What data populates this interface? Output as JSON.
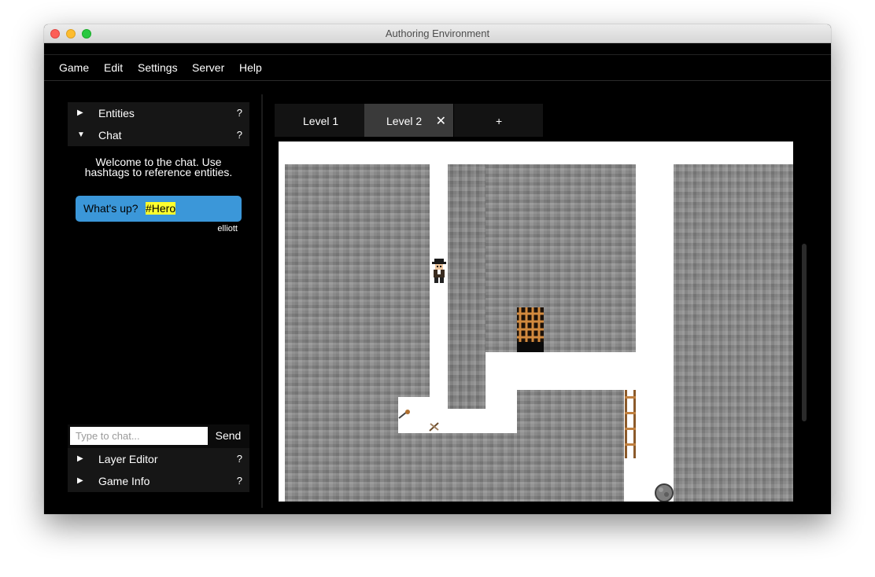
{
  "window": {
    "title": "Authoring Environment"
  },
  "menu": [
    "Game",
    "Edit",
    "Settings",
    "Server",
    "Help"
  ],
  "sidebar": {
    "sections": [
      {
        "label": "Entities",
        "help": "?",
        "expanded": false
      },
      {
        "label": "Chat",
        "help": "?",
        "expanded": true
      },
      {
        "label": "Layer Editor",
        "help": "?",
        "expanded": false
      },
      {
        "label": "Game Info",
        "help": "?",
        "expanded": false
      }
    ],
    "chat": {
      "welcome_line1": "Welcome to the chat. Use",
      "welcome_line2": "hashtags to reference entities.",
      "message": {
        "text": "What's up?",
        "hashtag": "#Hero",
        "author": "elliott"
      },
      "input_placeholder": "Type to chat...",
      "send_label": "Send"
    }
  },
  "tabs": [
    {
      "label": "Level 1",
      "active": false
    },
    {
      "label": "Level 2",
      "active": true,
      "close": "✕"
    },
    {
      "label": "+",
      "active": false
    }
  ],
  "colors": {
    "accent_bubble": "#3b97d9",
    "hashtag_highlight": "#ffff2e",
    "stone": "#888888"
  },
  "level": {
    "entities": [
      "hero",
      "portcullis",
      "ladder",
      "torch",
      "bones",
      "boulder"
    ]
  }
}
